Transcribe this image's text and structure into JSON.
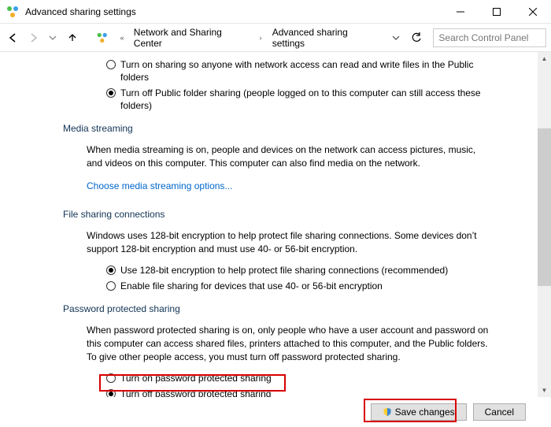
{
  "window": {
    "title": "Advanced sharing settings"
  },
  "breadcrumb": {
    "a": "Network and Sharing Center",
    "b": "Advanced sharing settings"
  },
  "search": {
    "placeholder": "Search Control Panel"
  },
  "public_folder": {
    "opt_on": "Turn on sharing so anyone with network access can read and write files in the Public folders",
    "opt_off": "Turn off Public folder sharing (people logged on to this computer can still access these folders)",
    "selected": "off"
  },
  "media": {
    "heading": "Media streaming",
    "desc": "When media streaming is on, people and devices on the network can access pictures, music, and videos on this computer. This computer can also find media on the network.",
    "link": "Choose media streaming options..."
  },
  "file_share": {
    "heading": "File sharing connections",
    "desc": "Windows uses 128-bit encryption to help protect file sharing connections. Some devices don’t support 128-bit encryption and must use 40- or 56-bit encryption.",
    "opt_128": "Use 128-bit encryption to help protect file sharing connections (recommended)",
    "opt_40": "Enable file sharing for devices that use 40- or 56-bit encryption",
    "selected": "128"
  },
  "password": {
    "heading": "Password protected sharing",
    "desc": "When password protected sharing is on, only people who have a user account and password on this computer can access shared files, printers attached to this computer, and the Public folders. To give other people access, you must turn off password protected sharing.",
    "opt_on": "Turn on password protected sharing",
    "opt_off": "Turn off password protected sharing",
    "selected": "off"
  },
  "buttons": {
    "save": "Save changes",
    "cancel": "Cancel"
  }
}
